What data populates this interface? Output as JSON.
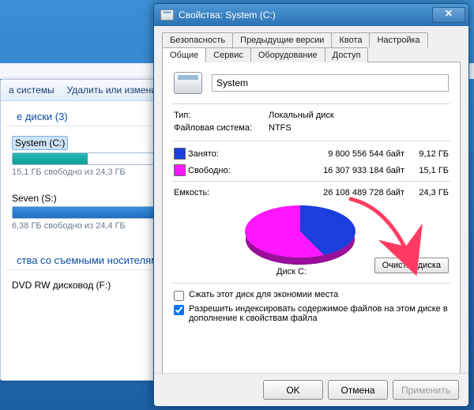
{
  "background": {
    "toolbar": {
      "item1": "а системы",
      "item2": "Удалить или измени"
    },
    "section_disks": "е диски (3)",
    "drives": [
      {
        "name": "System (C:)",
        "free": "15,1 ГБ свободно из 24,3 ГБ",
        "pct": 38,
        "color": "teal",
        "selected": true
      },
      {
        "name": "Seven (S:)",
        "free": "6,38 ГБ свободно из 24,4 ГБ",
        "pct": 74,
        "color": "blue",
        "selected": false
      }
    ],
    "section_removable": "ства со съемными носителям",
    "removable": "DVD RW дисковод (F:)"
  },
  "dialog": {
    "title": "Свойства: System (C:)",
    "tabs": {
      "security": "Безопасность",
      "prev": "Предыдущие версии",
      "quota": "Квота",
      "customize": "Настройка",
      "general": "Общие",
      "tools": "Сервис",
      "hardware": "Оборудование",
      "sharing": "Доступ"
    },
    "volume_name": "System",
    "labels": {
      "type": "Тип:",
      "fs": "Файловая система:",
      "used": "Занято:",
      "free": "Свободно:",
      "capacity": "Емкость:",
      "disk": "Диск C:",
      "cleanup": "Очистка диска",
      "compress": "Сжать этот диск для экономии места",
      "index": "Разрешить индексировать содержимое файлов на этом диске в дополнение к свойствам файла",
      "ok": "OK",
      "cancel": "Отмена",
      "apply": "Применить"
    },
    "values": {
      "type": "Локальный диск",
      "fs": "NTFS",
      "used_bytes": "9 800 556 544 байт",
      "used_gb": "9,12 ГБ",
      "free_bytes": "16 307 933 184 байт",
      "free_gb": "15,1 ГБ",
      "cap_bytes": "26 108 489 728 байт",
      "cap_gb": "24,3 ГБ"
    }
  }
}
